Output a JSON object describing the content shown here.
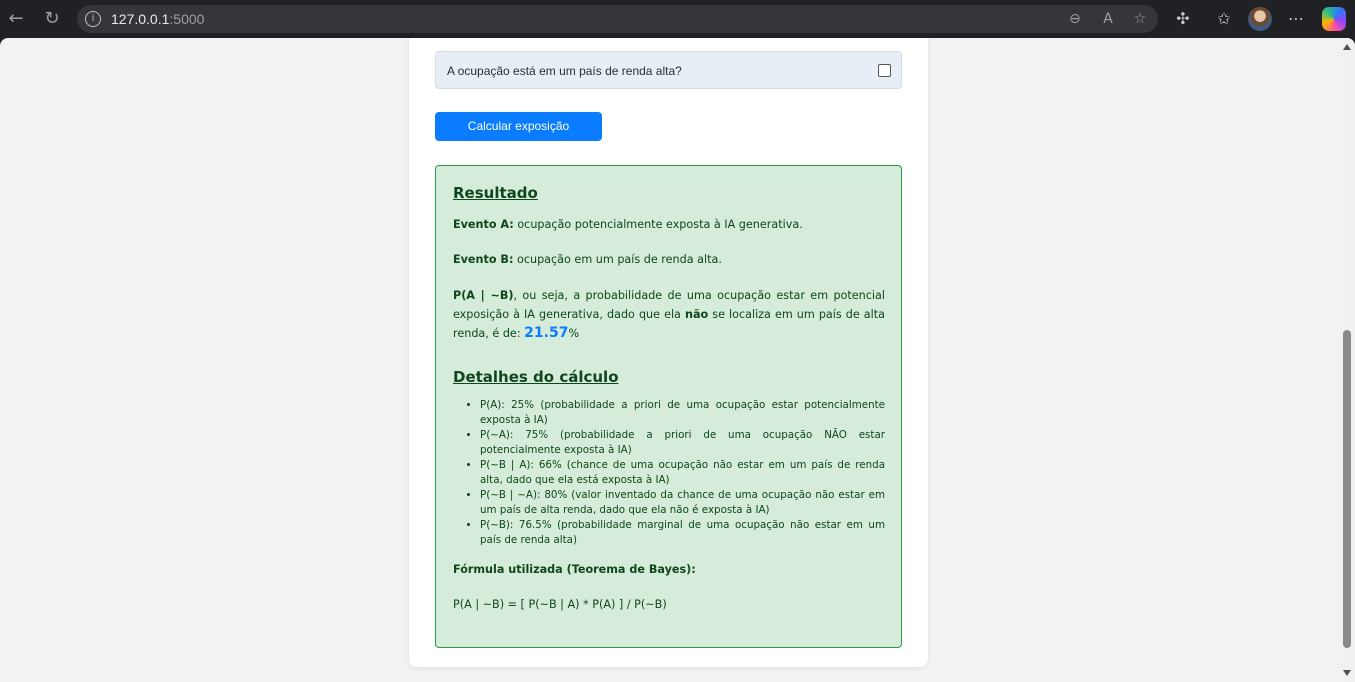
{
  "browser": {
    "url_host": "127.0.0.1",
    "url_port": ":5000"
  },
  "form": {
    "question": "A ocupação está em um país de renda alta?",
    "checkbox_checked": false,
    "submit_label": "Calcular exposição"
  },
  "result": {
    "title": "Resultado",
    "event_a_label": "Evento A:",
    "event_a_text": "ocupação potencialmente exposta à IA generativa.",
    "event_b_label": "Evento B:",
    "event_b_text": "ocupação em um país de renda alta.",
    "prob_label": "P(A | ~B)",
    "prob_text_1": ", ou seja, a probabilidade de uma ocupação estar em potencial exposição à IA generativa, dado que ela",
    "prob_not": "não",
    "prob_text_2": "se localiza em um país de alta renda, é de:",
    "prob_value": "21.57",
    "prob_unit": "%"
  },
  "details": {
    "title": "Detalhes do cálculo",
    "items": [
      "P(A): 25% (probabilidade a priori de uma ocupação estar potencialmente exposta à IA)",
      "P(~A): 75% (probabilidade a priori de uma ocupação NÃO estar potencialmente exposta à IA)",
      "P(~B | A): 66% (chance de uma ocupação não estar em um país de renda alta, dado que ela está exposta à IA)",
      "P(~B | ~A): 80% (valor inventado da chance de uma ocupação não estar em um país de alta renda, dado que ela não é exposta à IA)",
      "P(~B): 76.5% (probabilidade marginal de uma ocupação não estar em um país de renda alta)"
    ],
    "formula_label": "Fórmula utilizada (Teorema de Bayes):",
    "formula": "P(A | ~B) = [ P(~B | A) * P(A) ] / P(~B)"
  },
  "colors": {
    "accent": "#0a7cff",
    "result_bg": "#d4ecd9",
    "result_border": "#2a9a45",
    "result_text": "#10461d"
  }
}
